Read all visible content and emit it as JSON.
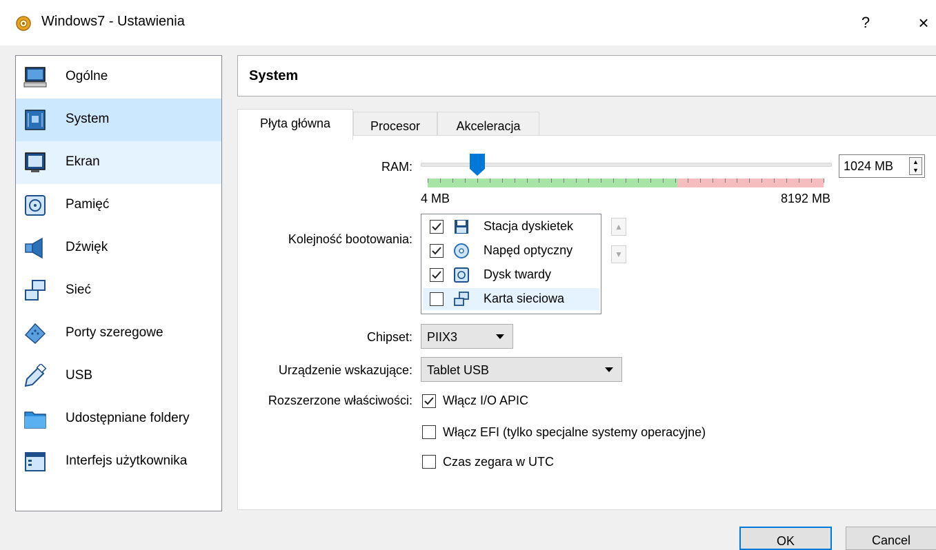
{
  "window": {
    "title": "Windows7 - Ustawienia",
    "help_label": "?",
    "close_label": "×"
  },
  "sidebar": {
    "items": [
      {
        "label": "Ogólne",
        "icon": "monitor-icon"
      },
      {
        "label": "System",
        "icon": "motherboard-icon"
      },
      {
        "label": "Ekran",
        "icon": "display-icon"
      },
      {
        "label": "Pamięć",
        "icon": "hard-disk-icon"
      },
      {
        "label": "Dźwięk",
        "icon": "speaker-icon"
      },
      {
        "label": "Sieć",
        "icon": "network-icon"
      },
      {
        "label": "Porty szeregowe",
        "icon": "serial-port-icon"
      },
      {
        "label": "USB",
        "icon": "usb-icon"
      },
      {
        "label": "Udostępniane foldery",
        "icon": "folder-icon"
      },
      {
        "label": "Interfejs użytkownika",
        "icon": "ui-window-icon"
      }
    ],
    "selected": "System"
  },
  "header": {
    "title": "System"
  },
  "tabs": [
    {
      "label": "Płyta główna",
      "active": true
    },
    {
      "label": "Procesor",
      "active": false
    },
    {
      "label": "Akceleracja",
      "active": false
    }
  ],
  "motherboard": {
    "ram": {
      "label": "RAM:",
      "value_text": "1024 MB",
      "value_mb": 1024,
      "min_label": "4 MB",
      "max_label": "8192 MB",
      "min_mb": 4,
      "max_mb": 8192,
      "recommended_fraction": 0.63,
      "colors": {
        "ok": "#a6e5a6",
        "warn": "#f5bdbd",
        "thumb": "#0078d7"
      }
    },
    "boot_order": {
      "label": "Kolejność bootowania:",
      "items": [
        {
          "label": "Stacja dyskietek",
          "checked": true,
          "icon": "floppy-icon"
        },
        {
          "label": "Napęd optyczny",
          "checked": true,
          "icon": "optical-disc-icon"
        },
        {
          "label": "Dysk twardy",
          "checked": true,
          "icon": "hard-disk-icon"
        },
        {
          "label": "Karta sieciowa",
          "checked": false,
          "icon": "network-card-icon"
        }
      ],
      "up_label": "▲",
      "down_label": "▼"
    },
    "chipset": {
      "label": "Chipset:",
      "value": "PIIX3"
    },
    "pointing_device": {
      "label": "Urządzenie wskazujące:",
      "value": "Tablet USB"
    },
    "extended": {
      "label": "Rozszerzone właściwości:",
      "options": [
        {
          "label": "Włącz I/O APIC",
          "checked": true
        },
        {
          "label": "Włącz EFI (tylko specjalne systemy operacyjne)",
          "checked": false
        },
        {
          "label": "Czas zegara w UTC",
          "checked": false
        }
      ]
    }
  },
  "buttons": {
    "ok": "OK",
    "cancel": "Cancel"
  }
}
